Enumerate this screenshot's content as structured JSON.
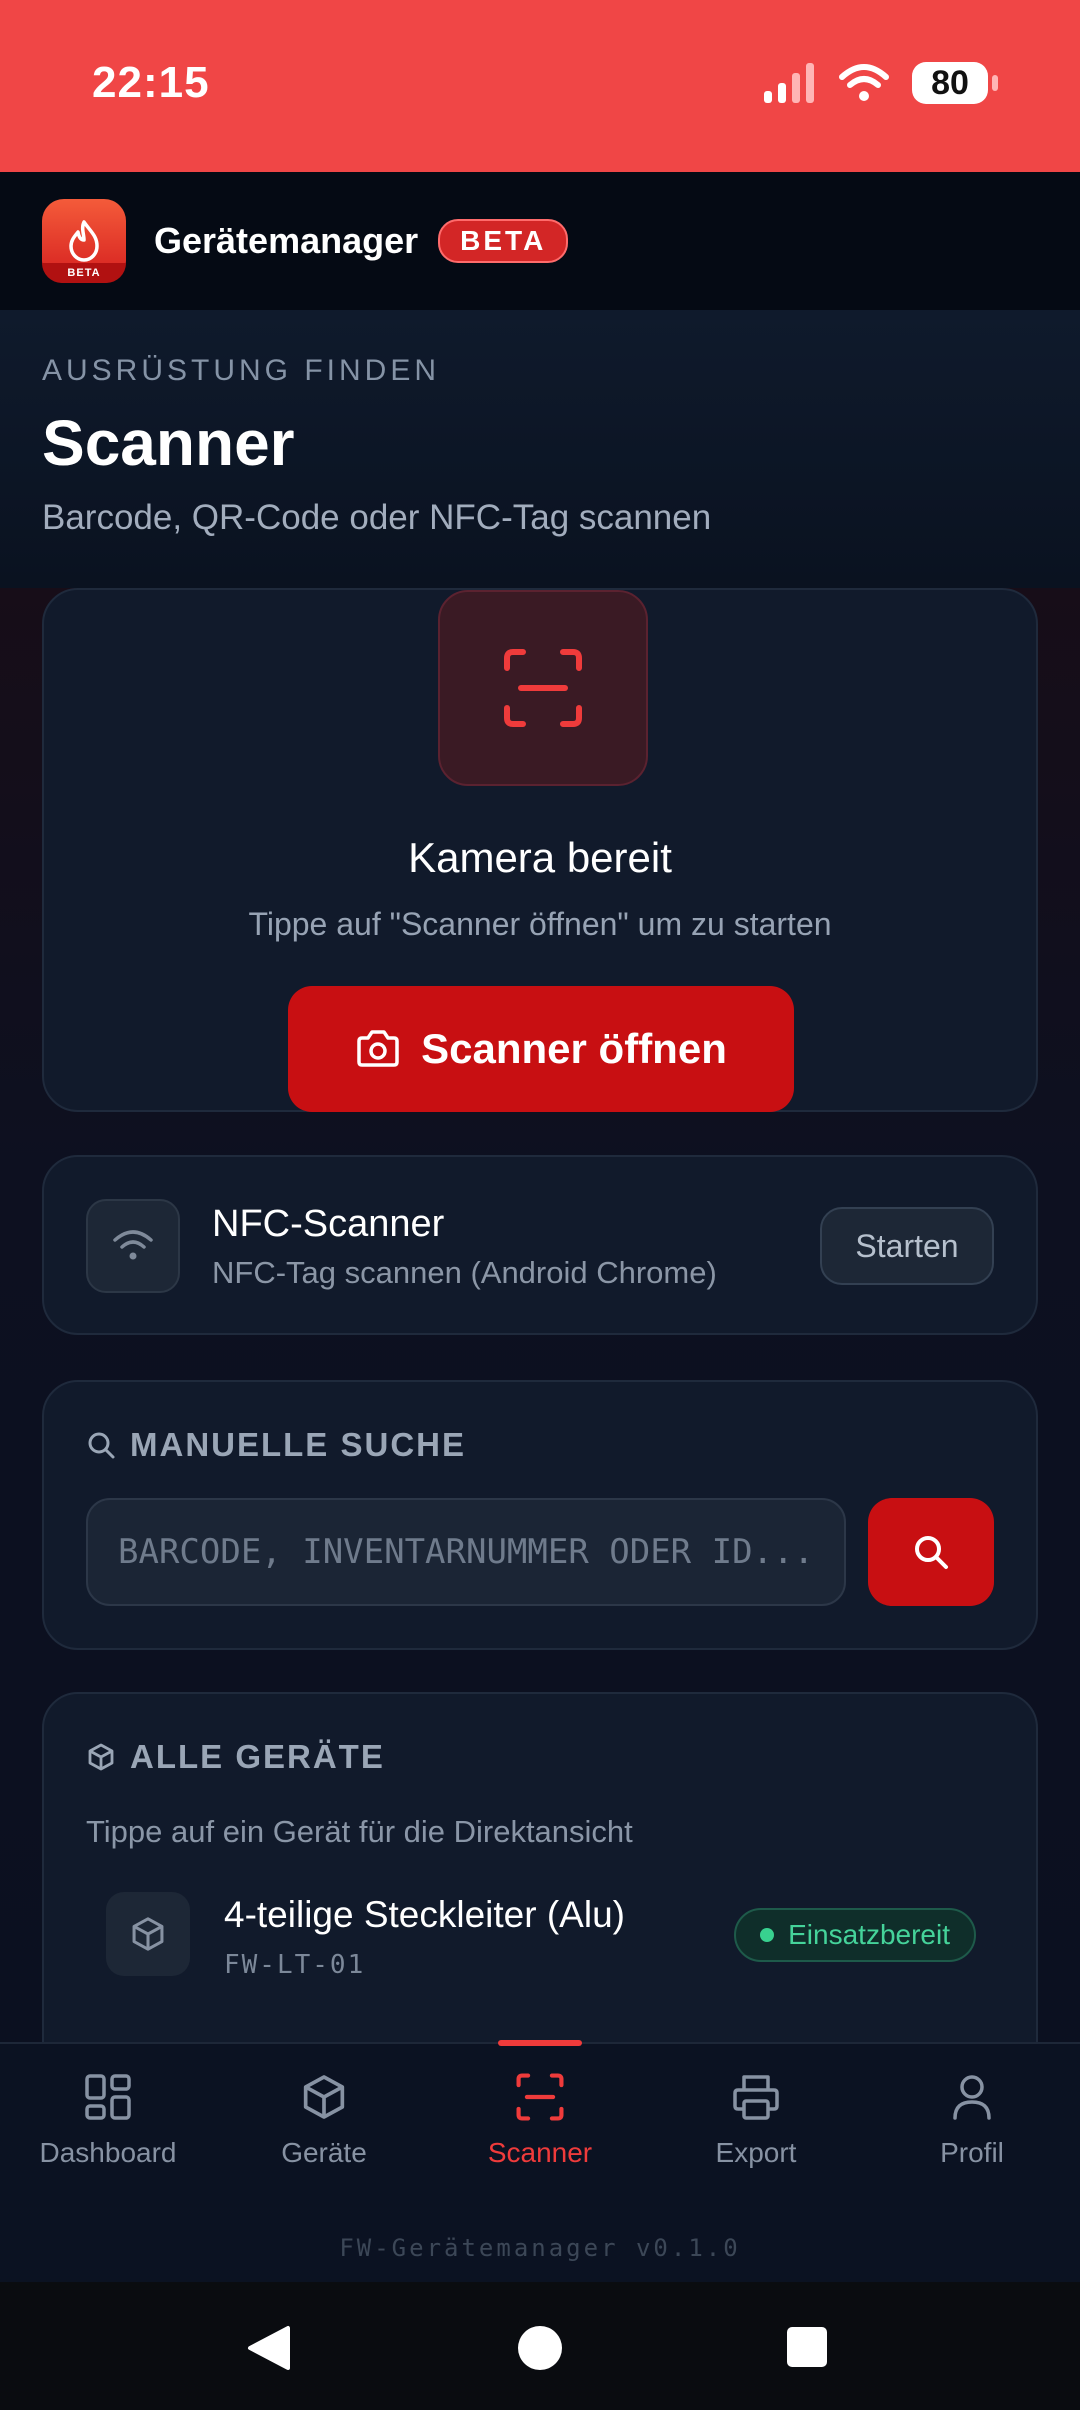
{
  "status_bar": {
    "time": "22:15",
    "battery": "80"
  },
  "app": {
    "title": "Gerätemanager",
    "badge": "BETA",
    "logo_badge": "BETA",
    "accent": "#c80f12"
  },
  "header": {
    "eyebrow": "AUSRÜSTUNG FINDEN",
    "title": "Scanner",
    "subtitle": "Barcode, QR-Code oder NFC-Tag scannen"
  },
  "scanner": {
    "title": "Kamera bereit",
    "hint": "Tippe auf \"Scanner öffnen\" um zu starten",
    "button_label": "Scanner öffnen"
  },
  "nfc": {
    "title": "NFC-Scanner",
    "subtitle": "NFC-Tag scannen (Android Chrome)",
    "button_label": "Starten"
  },
  "search": {
    "heading": "MANUELLE SUCHE",
    "placeholder": "BARCODE, INVENTARNUMMER ODER ID..."
  },
  "devices": {
    "heading": "ALLE GERÄTE",
    "hint": "Tippe auf ein Gerät für die Direktansicht",
    "items": [
      {
        "name": "4-teilige Steckleiter (Alu)",
        "id": "FW-LT-01",
        "status": "Einsatzbereit",
        "status_color": "#38d18f"
      }
    ]
  },
  "nav": {
    "items": [
      {
        "label": "Dashboard",
        "icon": "dashboard-icon"
      },
      {
        "label": "Geräte",
        "icon": "box-icon"
      },
      {
        "label": "Scanner",
        "icon": "scan-icon",
        "active": true
      },
      {
        "label": "Export",
        "icon": "printer-icon"
      },
      {
        "label": "Profil",
        "icon": "user-icon"
      }
    ],
    "version": "FW-Gerätemanager v0.1.0"
  }
}
